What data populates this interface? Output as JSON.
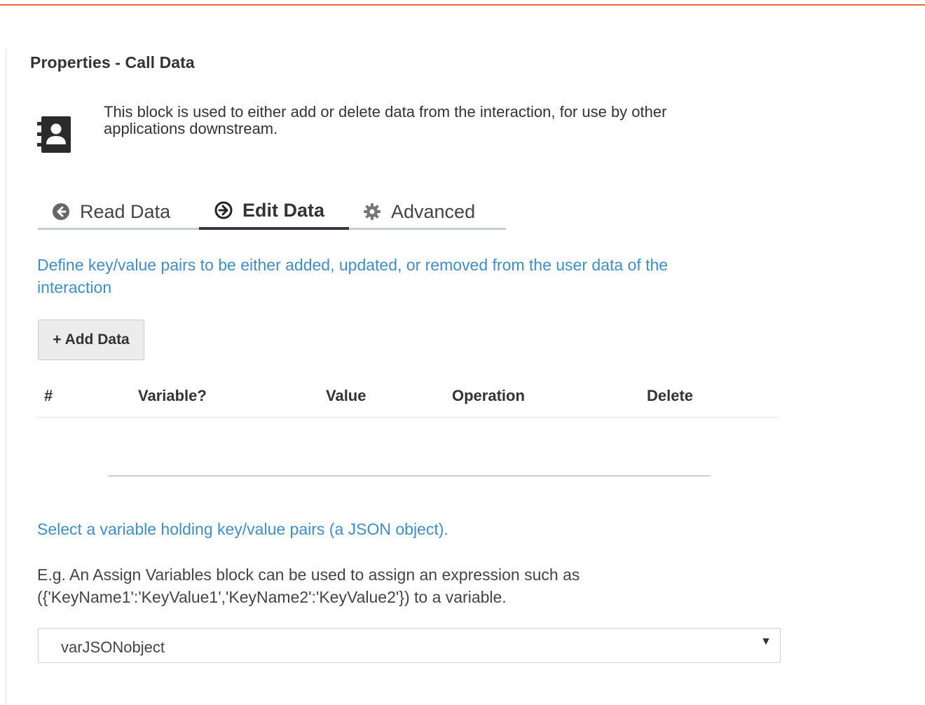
{
  "panel": {
    "title": "Properties - Call Data",
    "description": "This block is used to either add or delete data from the interaction, for use by other applications downstream.",
    "block_icon": "address-book-icon"
  },
  "tabs": [
    {
      "label": "Read Data",
      "icon": "arrow-circle-left-icon",
      "active": false
    },
    {
      "label": "Edit Data",
      "icon": "arrow-circle-right-icon",
      "active": true
    },
    {
      "label": "Advanced",
      "icon": "gear-icon",
      "active": false
    }
  ],
  "edit": {
    "instructions": "Define key/value pairs to be either added, updated, or removed from the user data of the interaction",
    "add_button": "+ Add Data",
    "table": {
      "columns": [
        "#",
        "Variable?",
        "Value",
        "Operation",
        "Delete"
      ],
      "rows": []
    },
    "select_hint": "Select a variable holding key/value pairs (a JSON object).",
    "example": "E.g. An Assign Variables block can be used to assign an expression such as ({'KeyName1':'KeyValue1','KeyName2':'KeyValue2'}) to a variable.",
    "variable_select": {
      "value": "varJSONobject",
      "arrow": "▼"
    }
  },
  "colors": {
    "accent_top": "#e8673a",
    "link_blue": "#3d8ecb",
    "tab_active": "#2f3a44"
  }
}
